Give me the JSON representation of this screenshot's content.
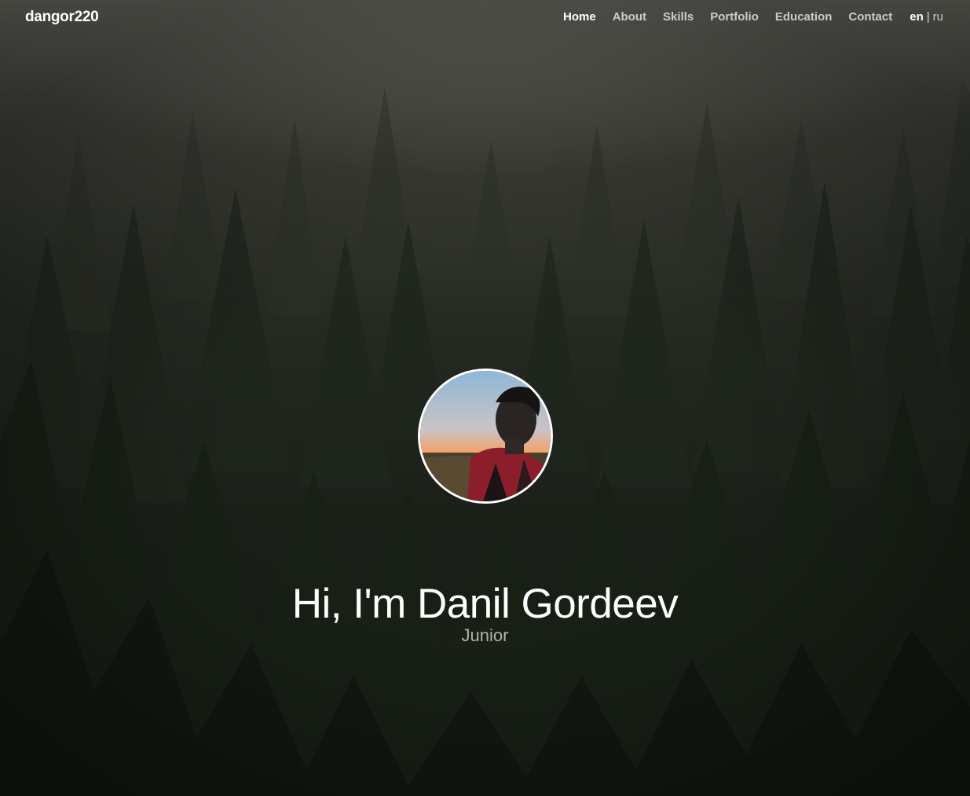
{
  "navbar": {
    "brand": "dangor220",
    "links": [
      {
        "label": "Home",
        "active": true
      },
      {
        "label": "About",
        "active": false
      },
      {
        "label": "Skills",
        "active": false
      },
      {
        "label": "Portfolio",
        "active": false
      },
      {
        "label": "Education",
        "active": false
      },
      {
        "label": "Contact",
        "active": false
      }
    ],
    "language": {
      "current": "en",
      "separator": "|",
      "other": "ru"
    }
  },
  "hero": {
    "headline": "Hi, I'm Danil Gordeev",
    "subtitle": "Junior",
    "avatar_icon": "profile-photo"
  },
  "colors": {
    "text": "#ffffff",
    "muted_text": "#b8bab4",
    "background_dark": "#151a14",
    "fog": "#6b6c63"
  }
}
